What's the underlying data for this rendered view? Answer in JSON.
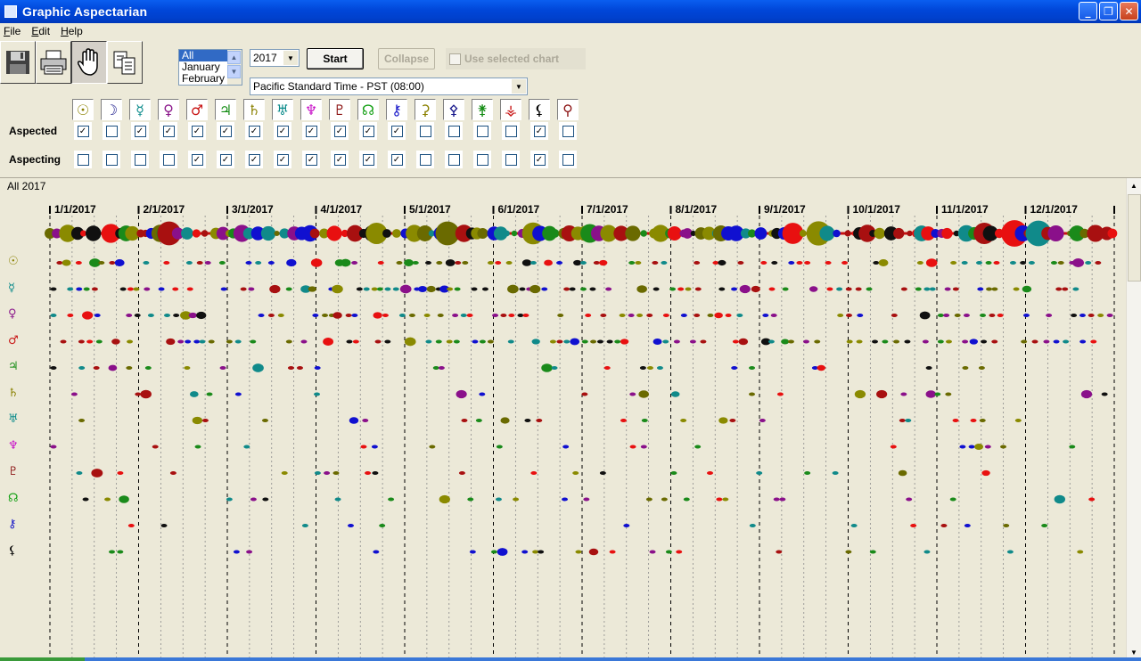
{
  "window": {
    "title": "Graphic Aspectarian",
    "controls": [
      "_",
      "❐",
      "✕"
    ]
  },
  "menu": [
    {
      "label": "File",
      "u": "F",
      "rest": "ile"
    },
    {
      "label": "Edit",
      "u": "E",
      "rest": "dit"
    },
    {
      "label": "Help",
      "u": "H",
      "rest": "elp"
    }
  ],
  "toolbar": {
    "buttons": [
      {
        "name": "save-button",
        "icon": "floppy-disk-icon"
      },
      {
        "name": "print-button",
        "icon": "printer-icon"
      },
      {
        "name": "hand-button",
        "icon": "hand-icon",
        "pressed": true
      },
      {
        "name": "copy-button",
        "icon": "copy-pages-icon"
      }
    ],
    "months": [
      "All",
      "January",
      "February"
    ],
    "year": "2017",
    "start": "Start",
    "collapse": "Collapse",
    "use_selected_chart": "Use selected chart",
    "timezone": "Pacific Standard Time - PST (08:00)"
  },
  "selection": {
    "aspected_label": "Aspected",
    "aspecting_label": "Aspecting",
    "planets": [
      {
        "glyph": "☉",
        "color": "#8a8000",
        "name": "sun"
      },
      {
        "glyph": "☽",
        "color": "#1a1a8c",
        "name": "moon"
      },
      {
        "glyph": "☿",
        "color": "#0a8a8a",
        "name": "mercury"
      },
      {
        "glyph": "♀",
        "color": "#8c1a8c",
        "name": "venus"
      },
      {
        "glyph": "♂",
        "color": "#c81414",
        "name": "mars"
      },
      {
        "glyph": "♃",
        "color": "#148c14",
        "name": "jupiter"
      },
      {
        "glyph": "♄",
        "color": "#8a8000",
        "name": "saturn"
      },
      {
        "glyph": "♅",
        "color": "#0a8a8a",
        "name": "uranus"
      },
      {
        "glyph": "♆",
        "color": "#c814c8",
        "name": "neptune"
      },
      {
        "glyph": "♇",
        "color": "#8c1414",
        "name": "pluto"
      },
      {
        "glyph": "☊",
        "color": "#14a014",
        "name": "node"
      },
      {
        "glyph": "⚷",
        "color": "#1414c8",
        "name": "chiron"
      },
      {
        "glyph": "⚳",
        "color": "#8a8000",
        "name": "ceres"
      },
      {
        "glyph": "⚴",
        "color": "#1a1a8c",
        "name": "pallas"
      },
      {
        "glyph": "⚵",
        "color": "#148c14",
        "name": "juno"
      },
      {
        "glyph": "⚶",
        "color": "#c81414",
        "name": "vesta"
      },
      {
        "glyph": "⚸",
        "color": "#000000",
        "name": "lilith"
      },
      {
        "glyph": "⚲",
        "color": "#8c1414",
        "name": "eris"
      }
    ],
    "aspected": [
      true,
      false,
      true,
      true,
      true,
      true,
      true,
      true,
      true,
      true,
      true,
      true,
      false,
      false,
      false,
      false,
      true,
      false
    ],
    "aspecting": [
      false,
      false,
      false,
      false,
      true,
      true,
      true,
      true,
      true,
      true,
      true,
      true,
      false,
      false,
      false,
      false,
      true,
      false
    ]
  },
  "chart_data": {
    "type": "scatter",
    "title": "All 2017",
    "x_axis": {
      "start": "2017-01-01",
      "end": "2017-12-31",
      "tick_labels": [
        "1/1/2017",
        "2/1/2017",
        "3/1/2017",
        "4/1/2017",
        "5/1/2017",
        "6/1/2017",
        "7/1/2017",
        "8/1/2017",
        "9/1/2017",
        "10/1/2017",
        "11/1/2017",
        "12/1/2017"
      ]
    },
    "rows": [
      {
        "name": "all",
        "glyph": ""
      },
      {
        "name": "sun",
        "glyph": "☉",
        "color": "#8a8000"
      },
      {
        "name": "mercury",
        "glyph": "☿",
        "color": "#0a8a8a"
      },
      {
        "name": "venus",
        "glyph": "♀",
        "color": "#8c1a8c"
      },
      {
        "name": "mars",
        "glyph": "♂",
        "color": "#c81414"
      },
      {
        "name": "jupiter",
        "glyph": "♃",
        "color": "#148c14"
      },
      {
        "name": "saturn",
        "glyph": "♄",
        "color": "#8a8000"
      },
      {
        "name": "uranus",
        "glyph": "♅",
        "color": "#0a8a8a"
      },
      {
        "name": "neptune",
        "glyph": "♆",
        "color": "#c814c8"
      },
      {
        "name": "pluto",
        "glyph": "♇",
        "color": "#8c1414"
      },
      {
        "name": "node",
        "glyph": "☊",
        "color": "#14a014"
      },
      {
        "name": "chiron",
        "glyph": "⚷",
        "color": "#1414c8"
      },
      {
        "name": "lilith",
        "glyph": "⚸",
        "color": "#000000"
      }
    ],
    "palette": [
      "#e81010",
      "#1010d0",
      "#101010",
      "#8a8a00",
      "#108a8a",
      "#8a108a",
      "#a81010",
      "#6a6a00",
      "#1a8a1a"
    ],
    "grid": "dashed"
  }
}
